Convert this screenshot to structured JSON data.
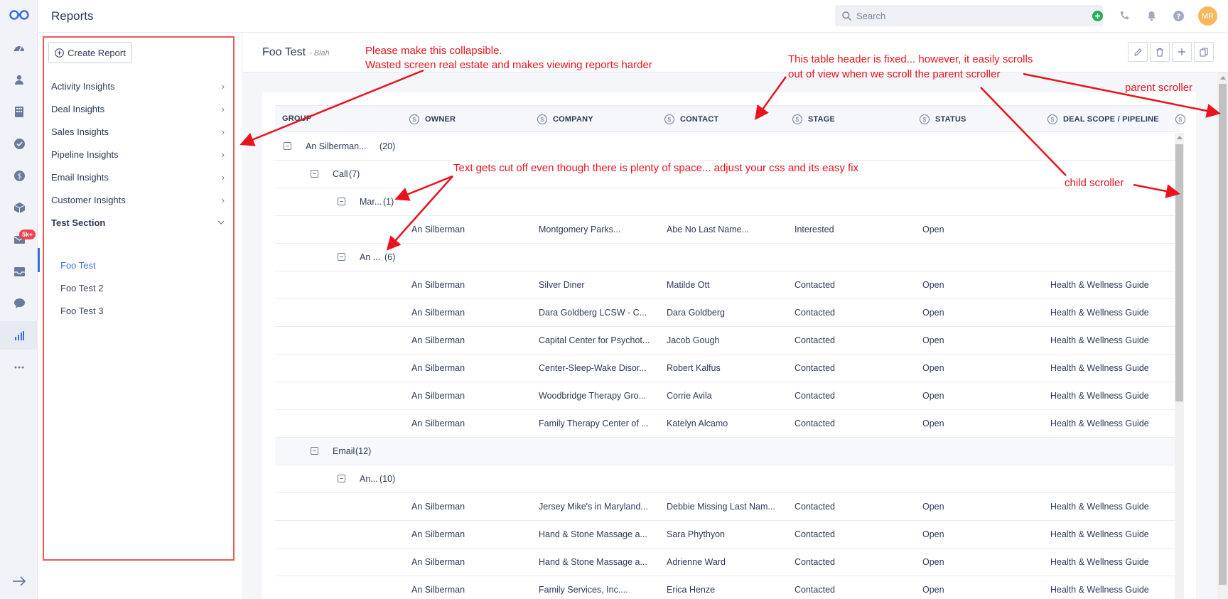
{
  "app": {
    "title": "Reports"
  },
  "search": {
    "placeholder": "Search"
  },
  "user": {
    "initials": "MR"
  },
  "rail": {
    "badge": "5k+"
  },
  "sidebar": {
    "create_label": "Create Report",
    "items": [
      {
        "label": "Activity Insights"
      },
      {
        "label": "Deal Insights"
      },
      {
        "label": "Sales Insights"
      },
      {
        "label": "Pipeline Insights"
      },
      {
        "label": "Email Insights"
      },
      {
        "label": "Customer Insights"
      },
      {
        "label": "Test Section"
      }
    ],
    "sub_items": [
      {
        "label": "Foo Test"
      },
      {
        "label": "Foo Test 2"
      },
      {
        "label": "Foo Test 3"
      }
    ]
  },
  "report": {
    "title": "Foo Test",
    "subtitle": "- Blah"
  },
  "table": {
    "headers": [
      "GROUP",
      "OWNER",
      "COMPANY",
      "CONTACT",
      "STAGE",
      "STATUS",
      "DEAL SCOPE / PIPELINE"
    ],
    "groups": [
      {
        "label": "An Silberman...",
        "count": "(20)"
      },
      {
        "label": "Call",
        "count": "(7)"
      },
      {
        "label": "Mar...",
        "count": "(1)"
      },
      {
        "label": "An ...",
        "count": "(6)"
      },
      {
        "label": "Email",
        "count": "(12)"
      },
      {
        "label": "An...",
        "count": "(10)"
      }
    ],
    "rows": [
      [
        "An Silberman",
        "Montgomery Parks...",
        "Abe No Last Name...",
        "Interested",
        "Open",
        ""
      ],
      [
        "An Silberman",
        "Silver Diner",
        "Matilde Ott",
        "Contacted",
        "Open",
        "Health & Wellness Guide"
      ],
      [
        "An Silberman",
        "Dara Goldberg LCSW - C...",
        "Dara Goldberg",
        "Contacted",
        "Open",
        "Health & Wellness Guide"
      ],
      [
        "An Silberman",
        "Capital Center for Psychot...",
        "Jacob Gough",
        "Contacted",
        "Open",
        "Health & Wellness Guide"
      ],
      [
        "An Silberman",
        "Center-Sleep-Wake Disor...",
        "Robert Kalfus",
        "Contacted",
        "Open",
        "Health & Wellness Guide"
      ],
      [
        "An Silberman",
        "Woodbridge Therapy Gro...",
        "Corrie Avila",
        "Contacted",
        "Open",
        "Health & Wellness Guide"
      ],
      [
        "An Silberman",
        "Family Therapy Center of ...",
        "Katelyn Alcamo",
        "Contacted",
        "Open",
        "Health & Wellness Guide"
      ],
      [
        "An Silberman",
        "Jersey Mike's in Maryland...",
        "Debbie Missing Last Nam...",
        "Contacted",
        "Open",
        "Health & Wellness Guide"
      ],
      [
        "An Silberman",
        "Hand & Stone Massage a...",
        "Sara Phythyon",
        "Contacted",
        "Open",
        "Health & Wellness Guide"
      ],
      [
        "An Silberman",
        "Hand & Stone Massage a...",
        "Adrienne Ward",
        "Contacted",
        "Open",
        "Health & Wellness Guide"
      ],
      [
        "An Silberman",
        "Family Services, Inc....",
        "Erica Henze",
        "Contacted",
        "Open",
        "Health & Wellness Guide"
      ]
    ]
  },
  "annotations": {
    "collapse_1": "Please make this collapsible.",
    "collapse_2": "Wasted screen real estate and makes viewing reports harder",
    "header_1": "This table header is fixed... however, it easily scrolls",
    "header_2": "out of view when we scroll the parent scroller",
    "cutoff": "Text gets cut off even though there is plenty of space... adjust your css and its easy fix",
    "parent": "parent scroller",
    "child": "child scroller"
  },
  "colors": {
    "accent": "#3b6fe0",
    "annotation": "#e8131b",
    "badge": "#f0414f",
    "avatar": "#f6b85a"
  }
}
